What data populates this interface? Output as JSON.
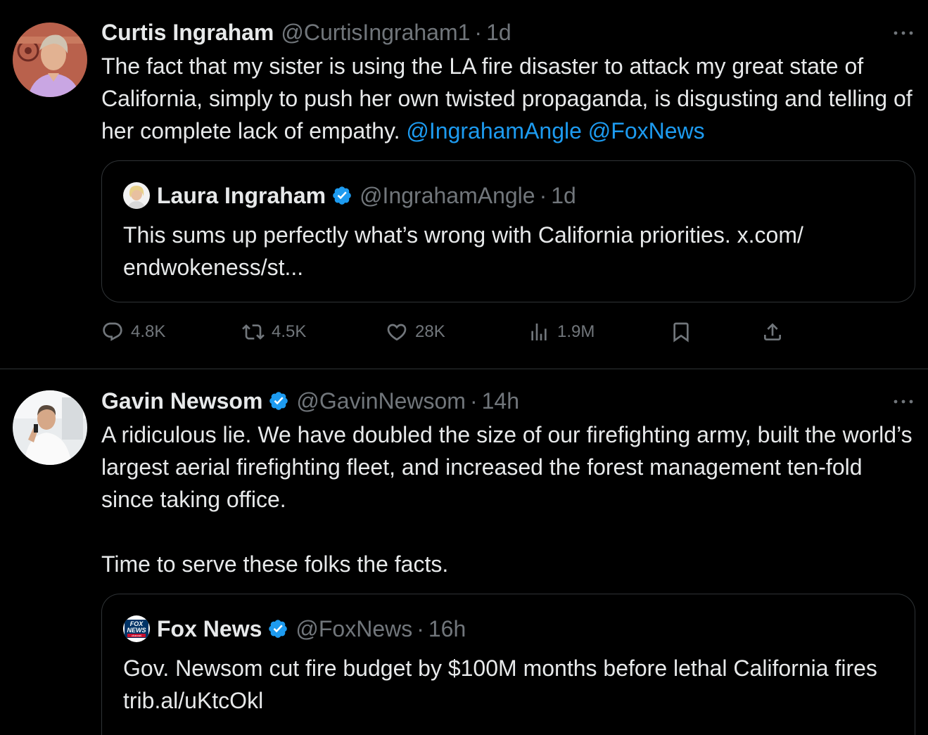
{
  "tweets": [
    {
      "author": {
        "name": "Curtis Ingraham",
        "handle": "@CurtisIngraham1",
        "time": "1d",
        "verified": false
      },
      "dot": "·",
      "text_plain": "The fact that my sister is using the LA fire disaster to attack my great state of California, simply to push her own twisted propaganda, is disgusting and telling of her complete lack of empathy. ",
      "mentions": [
        "@IngrahamAngle",
        "@FoxNews"
      ],
      "quote": {
        "author": {
          "name": "Laura Ingraham",
          "handle": "@IngrahamAngle",
          "time": "1d",
          "verified": true
        },
        "text": "This sums up perfectly what’s wrong with California priorities. x.com/\nendwokeness/st..."
      },
      "actions": {
        "replies": "4.8K",
        "reposts": "4.5K",
        "likes": "28K",
        "views": "1.9M"
      }
    },
    {
      "author": {
        "name": "Gavin Newsom",
        "handle": "@GavinNewsom",
        "time": "14h",
        "verified": true
      },
      "dot": "·",
      "text": "A ridiculous lie. We have doubled the size of our firefighting army, built the world’s largest aerial firefighting fleet, and increased the forest management ten-fold since taking office.\n\nTime to serve these folks the facts.",
      "quote": {
        "author": {
          "name": "Fox News",
          "handle": "@FoxNews",
          "time": "16h",
          "verified": true,
          "logo_text_1": "FOX",
          "logo_text_2": "NEWS",
          "logo_text_3": "channel"
        },
        "text": "Gov. Newsom cut fire budget by $100M months before lethal California fires trib.al/uKtcOkl"
      }
    }
  ],
  "colors": {
    "background": "#000000",
    "text": "#e7e9ea",
    "secondary": "#71767b",
    "accent": "#1d9bf0",
    "border": "#2f3336"
  },
  "icons": [
    "more-icon",
    "verified-icon",
    "reply-icon",
    "repost-icon",
    "like-icon",
    "views-icon",
    "bookmark-icon",
    "share-icon"
  ]
}
